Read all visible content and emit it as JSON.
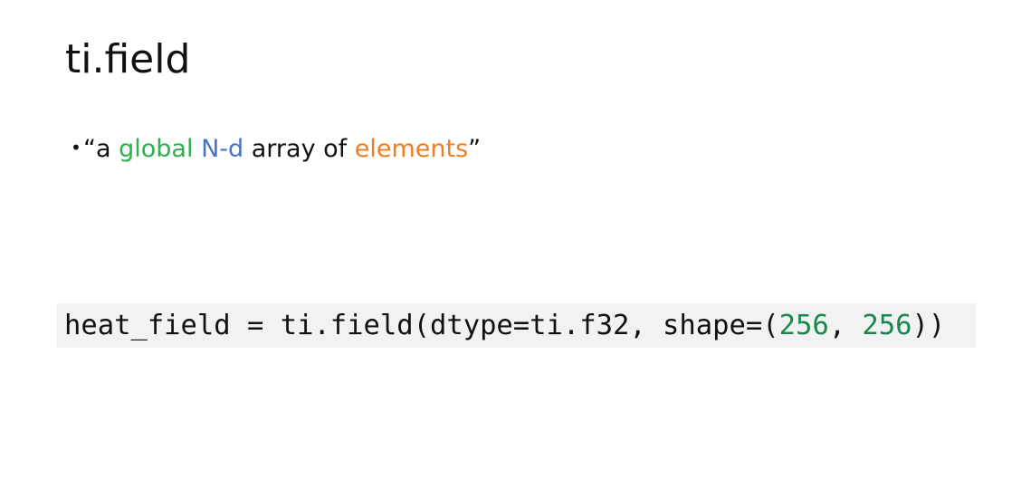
{
  "slide": {
    "title": "ti.field",
    "bullet": {
      "marker": "•",
      "open_quote": "“a ",
      "word_global": "global",
      "space1": " ",
      "word_nd": "N-d",
      "middle": " array of ",
      "word_elements": "elements",
      "close_quote": "”"
    },
    "code": {
      "prefix": "heat_field = ti.field(dtype=ti.f32, shape=(",
      "num1": "256",
      "sep": ", ",
      "num2": "256",
      "suffix": "))"
    }
  },
  "colors": {
    "global_word": "#2ab24d",
    "nd_word": "#4a72c7",
    "elements_word": "#ef7d22",
    "code_number": "#168a4d",
    "code_background": "#f2f2f2"
  }
}
